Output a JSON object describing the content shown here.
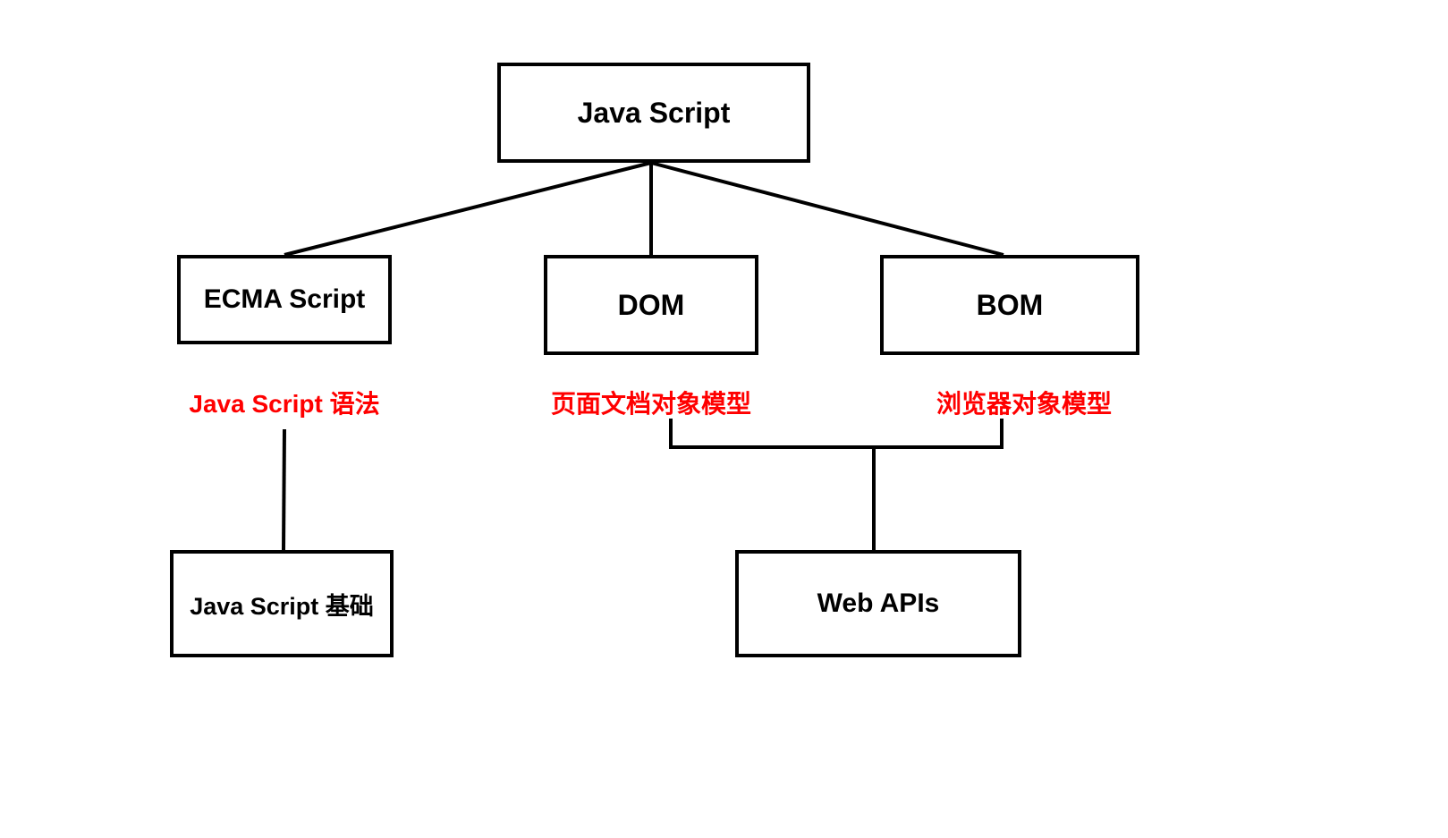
{
  "diagram": {
    "root": {
      "label": "Java Script"
    },
    "children": [
      {
        "label": "ECMA Script",
        "caption": "Java Script 语法",
        "descends_to": "Java Script 基础"
      },
      {
        "label": "DOM",
        "caption": "页面文档对象模型"
      },
      {
        "label": "BOM",
        "caption": "浏览器对象模型"
      }
    ],
    "grouped_descendant": {
      "label": "Web APIs",
      "parents": [
        "DOM",
        "BOM"
      ]
    },
    "leaf_left": {
      "label": "Java Script 基础"
    },
    "colors": {
      "box_border": "#000000",
      "caption_text": "#ff0000",
      "background": "#ffffff"
    }
  }
}
